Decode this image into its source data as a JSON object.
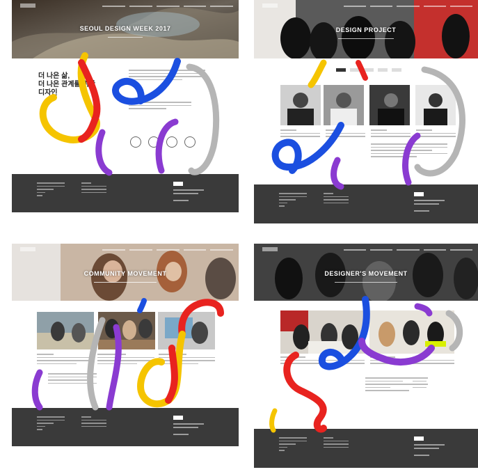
{
  "thumbnails": [
    {
      "hero_title": "SEOUL DESIGN WEEK 2017",
      "intro_heading_lines": [
        "더 나은 삶,",
        "더 나은 관계를 위한",
        "디자인"
      ]
    },
    {
      "hero_title": "DESIGN PROJECT"
    },
    {
      "hero_title": "COMMUNITY MOVEMENT"
    },
    {
      "hero_title": "DESIGNER'S MOVEMENT"
    }
  ],
  "colors": {
    "red": "#e8231f",
    "yellow": "#f5c400",
    "blue": "#1b4fe0",
    "purple": "#8a3bd1",
    "gray": "#b5b5b5",
    "footer": "#3a3a3a"
  }
}
